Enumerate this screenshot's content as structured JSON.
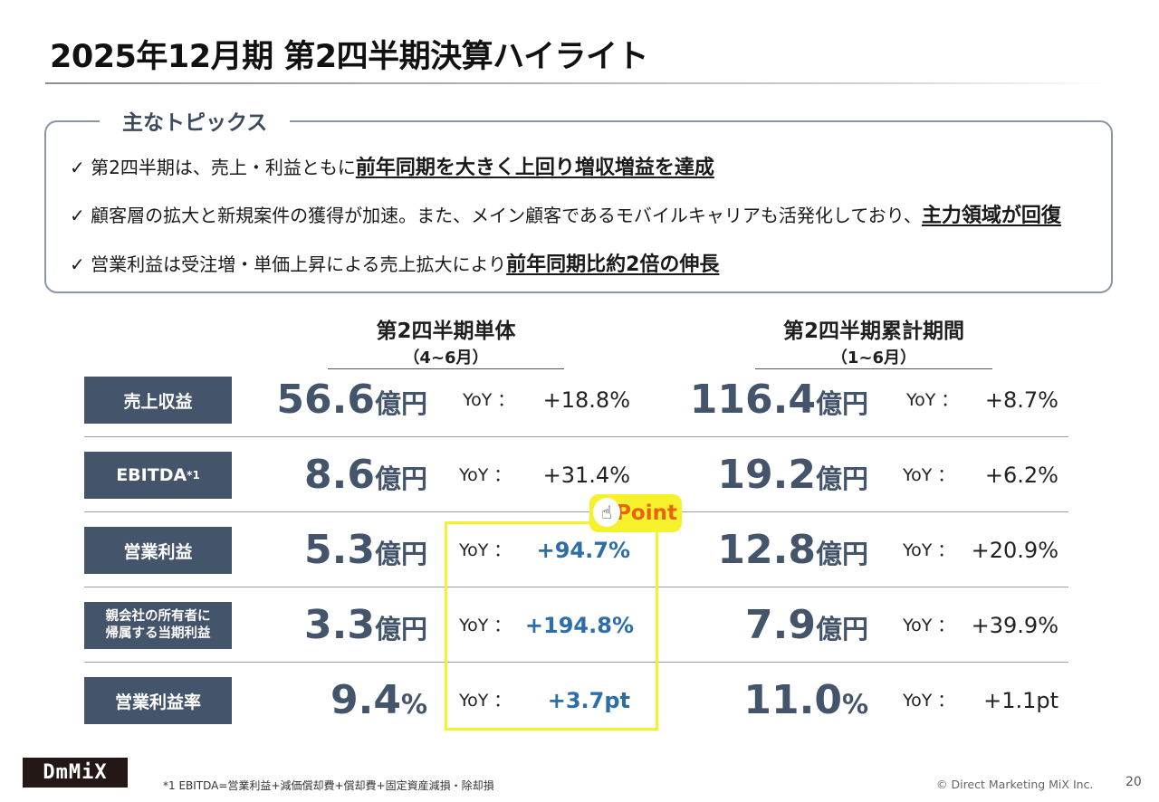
{
  "title": "2025年12月期 第2四半期決算ハイライト",
  "topics": {
    "heading": "主なトピックス",
    "items": [
      {
        "text": "✓ 第2四半期は、売上・利益ともに",
        "emphasis": "前年同期を大きく上回り増収増益を達成"
      },
      {
        "text": "✓ 顧客層の拡大と新規案件の獲得が加速。また、メイン顧客であるモバイルキャリアも活発化しており、",
        "emphasis": "主力領域が回復"
      },
      {
        "text": "✓ 営業利益は受注増・単価上昇による売上拡大により",
        "emphasis": "前年同期比約2倍の伸長"
      }
    ]
  },
  "columns": {
    "q2": {
      "title": "第2四半期単体",
      "period": "（4~6月）"
    },
    "h1": {
      "title": "第2四半期累計期間",
      "period": "（1~6月）"
    }
  },
  "yoy_label": "YoY ：",
  "rows": [
    {
      "label": "売上収益",
      "q2_value": "56.6",
      "q2_unit": "億円",
      "q2_yoy": "+18.8%",
      "h1_value": "116.4",
      "h1_unit": "億円",
      "h1_yoy": "+8.7%"
    },
    {
      "label": "EBITDA",
      "label_sup": "*1",
      "q2_value": "8.6",
      "q2_unit": "億円",
      "q2_yoy": "+31.4%",
      "h1_value": "19.2",
      "h1_unit": "億円",
      "h1_yoy": "+6.2%"
    },
    {
      "label": "営業利益",
      "q2_value": "5.3",
      "q2_unit": "億円",
      "q2_yoy": "+94.7%",
      "h1_value": "12.8",
      "h1_unit": "億円",
      "h1_yoy": "+20.9%"
    },
    {
      "label_line1": "親会社の所有者に",
      "label_line2": "帰属する当期利益",
      "q2_value": "3.3",
      "q2_unit": "億円",
      "q2_yoy": "+194.8%",
      "h1_value": "7.9",
      "h1_unit": "億円",
      "h1_yoy": "+39.9%"
    },
    {
      "label": "営業利益率",
      "q2_value": "9.4",
      "q2_unit": "%",
      "q2_yoy": "+3.7pt",
      "h1_value": "11.0",
      "h1_unit": "%",
      "h1_yoy": "+1.1pt"
    }
  ],
  "point_badge": "Point",
  "logo": "DmMiX",
  "footnote": "*1  EBITDA=営業利益+減価償却費+償却費+固定資産減損・除却損",
  "copyright": "© Direct Marketing MiX Inc.",
  "page_number": "20",
  "colors": {
    "label_bg": "#44546a",
    "value": "#44546a",
    "highlight_value": "#2e6ea8",
    "point_yellow": "#f5f12b",
    "point_text": "#e8640c"
  }
}
